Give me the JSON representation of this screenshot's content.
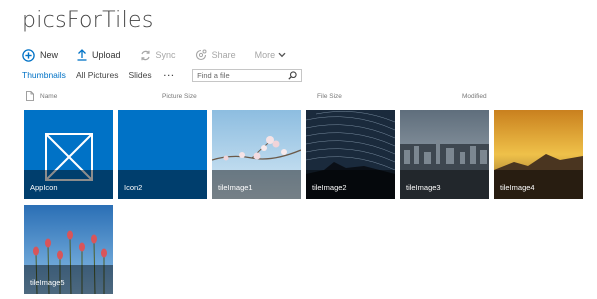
{
  "library": {
    "title": "picsForTiles"
  },
  "commands": {
    "new": "New",
    "upload": "Upload",
    "sync": "Sync",
    "share": "Share",
    "more": "More"
  },
  "views": {
    "thumbnails": "Thumbnails",
    "all_pictures": "All Pictures",
    "slides": "Slides",
    "ellipsis": "···"
  },
  "search": {
    "placeholder": "Find a file"
  },
  "columns": {
    "name": "Name",
    "picture_size": "Picture Size",
    "file_size": "File Size",
    "modified": "Modified"
  },
  "tiles": [
    {
      "name": "AppIcon"
    },
    {
      "name": "Icon2"
    },
    {
      "name": "tileImage1"
    },
    {
      "name": "tileImage2"
    },
    {
      "name": "tileImage3"
    },
    {
      "name": "tileImage4"
    },
    {
      "name": "tileImage5"
    }
  ],
  "colors": {
    "accent": "#0072c6",
    "tile_blue": "#0072c6",
    "disabled_text": "#a6a6a6"
  }
}
